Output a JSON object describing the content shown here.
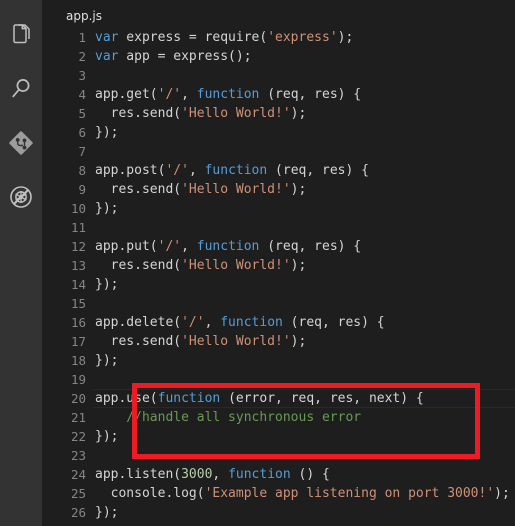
{
  "window": {
    "background_color": "#1e1e1e",
    "activity_bar_color": "#333333"
  },
  "activity_bar": {
    "items": [
      {
        "icon": "files-explorer-icon",
        "label": "Explorer"
      },
      {
        "icon": "search-icon",
        "label": "Search"
      },
      {
        "icon": "source-control-icon",
        "label": "Source Control"
      },
      {
        "icon": "run-debug-icon",
        "label": "Run and Debug"
      }
    ]
  },
  "editor": {
    "breadcrumb": "app.js",
    "active_line_number": 20,
    "theme_colors": {
      "keyword": "#569cd6",
      "string": "#ce9178",
      "number": "#b5cea8",
      "comment": "#6a9955",
      "identifier": "#d4d4d4",
      "line_number": "#858585",
      "annotation": "#ed1c24"
    },
    "lines": [
      {
        "number": "1",
        "tokens": [
          {
            "t": "var",
            "c": "t-kw"
          },
          {
            "t": " express = require(",
            "c": "t-id"
          },
          {
            "t": "'express'",
            "c": "t-str"
          },
          {
            "t": ");",
            "c": "t-id"
          }
        ]
      },
      {
        "number": "2",
        "tokens": [
          {
            "t": "var",
            "c": "t-kw"
          },
          {
            "t": " app = express();",
            "c": "t-id"
          }
        ]
      },
      {
        "number": "3",
        "tokens": []
      },
      {
        "number": "4",
        "tokens": [
          {
            "t": "app.get(",
            "c": "t-id"
          },
          {
            "t": "'/'",
            "c": "t-str"
          },
          {
            "t": ", ",
            "c": "t-id"
          },
          {
            "t": "function",
            "c": "t-kw"
          },
          {
            "t": " (req, res) {",
            "c": "t-id"
          }
        ]
      },
      {
        "number": "5",
        "tokens": [
          {
            "t": "  res.send(",
            "c": "t-id"
          },
          {
            "t": "'Hello World!'",
            "c": "t-str"
          },
          {
            "t": ");",
            "c": "t-id"
          }
        ]
      },
      {
        "number": "6",
        "tokens": [
          {
            "t": "});",
            "c": "t-id"
          }
        ]
      },
      {
        "number": "7",
        "tokens": []
      },
      {
        "number": "8",
        "tokens": [
          {
            "t": "app.post(",
            "c": "t-id"
          },
          {
            "t": "'/'",
            "c": "t-str"
          },
          {
            "t": ", ",
            "c": "t-id"
          },
          {
            "t": "function",
            "c": "t-kw"
          },
          {
            "t": " (req, res) {",
            "c": "t-id"
          }
        ]
      },
      {
        "number": "9",
        "tokens": [
          {
            "t": "  res.send(",
            "c": "t-id"
          },
          {
            "t": "'Hello World!'",
            "c": "t-str"
          },
          {
            "t": ");",
            "c": "t-id"
          }
        ]
      },
      {
        "number": "10",
        "tokens": [
          {
            "t": "});",
            "c": "t-id"
          }
        ]
      },
      {
        "number": "11",
        "tokens": []
      },
      {
        "number": "12",
        "tokens": [
          {
            "t": "app.put(",
            "c": "t-id"
          },
          {
            "t": "'/'",
            "c": "t-str"
          },
          {
            "t": ", ",
            "c": "t-id"
          },
          {
            "t": "function",
            "c": "t-kw"
          },
          {
            "t": " (req, res) {",
            "c": "t-id"
          }
        ]
      },
      {
        "number": "13",
        "tokens": [
          {
            "t": "  res.send(",
            "c": "t-id"
          },
          {
            "t": "'Hello World!'",
            "c": "t-str"
          },
          {
            "t": ");",
            "c": "t-id"
          }
        ]
      },
      {
        "number": "14",
        "tokens": [
          {
            "t": "});",
            "c": "t-id"
          }
        ]
      },
      {
        "number": "15",
        "tokens": []
      },
      {
        "number": "16",
        "tokens": [
          {
            "t": "app.delete(",
            "c": "t-id"
          },
          {
            "t": "'/'",
            "c": "t-str"
          },
          {
            "t": ", ",
            "c": "t-id"
          },
          {
            "t": "function",
            "c": "t-kw"
          },
          {
            "t": " (req, res) {",
            "c": "t-id"
          }
        ]
      },
      {
        "number": "17",
        "tokens": [
          {
            "t": "  res.send(",
            "c": "t-id"
          },
          {
            "t": "'Hello World!'",
            "c": "t-str"
          },
          {
            "t": ");",
            "c": "t-id"
          }
        ]
      },
      {
        "number": "18",
        "tokens": [
          {
            "t": "});",
            "c": "t-id"
          }
        ]
      },
      {
        "number": "19",
        "tokens": []
      },
      {
        "number": "20",
        "tokens": [
          {
            "t": "app.use(",
            "c": "t-id"
          },
          {
            "t": "function",
            "c": "t-kw"
          },
          {
            "t": " (error, req, res, next) {",
            "c": "t-id"
          }
        ],
        "active": true
      },
      {
        "number": "21",
        "tokens": [
          {
            "t": "    //handle all synchronous error",
            "c": "t-com"
          }
        ]
      },
      {
        "number": "22",
        "tokens": [
          {
            "t": "});",
            "c": "t-id"
          }
        ]
      },
      {
        "number": "23",
        "tokens": []
      },
      {
        "number": "24",
        "tokens": [
          {
            "t": "app.listen(",
            "c": "t-id"
          },
          {
            "t": "3000",
            "c": "t-num"
          },
          {
            "t": ", ",
            "c": "t-id"
          },
          {
            "t": "function",
            "c": "t-kw"
          },
          {
            "t": " () {",
            "c": "t-id"
          }
        ]
      },
      {
        "number": "25",
        "tokens": [
          {
            "t": "  console.log(",
            "c": "t-id"
          },
          {
            "t": "'Example app listening on port 3000!'",
            "c": "t-str"
          },
          {
            "t": ");",
            "c": "t-id"
          }
        ]
      },
      {
        "number": "26",
        "tokens": [
          {
            "t": "});",
            "c": "t-id"
          }
        ]
      }
    ]
  },
  "annotation": {
    "shape": "rectangle",
    "color": "#ed1c24",
    "covers_lines": "20-22"
  }
}
